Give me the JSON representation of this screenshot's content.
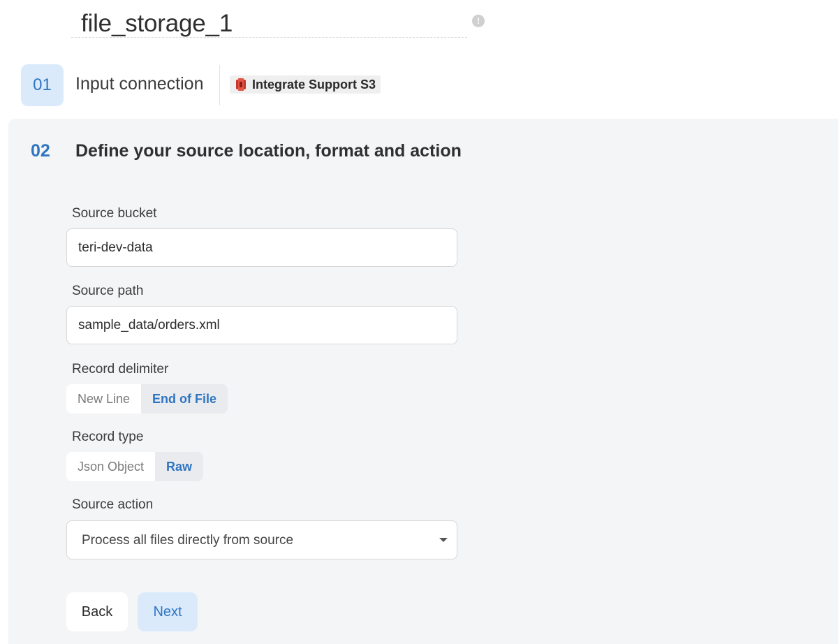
{
  "header": {
    "pipeline_name": "file_storage_1"
  },
  "step1": {
    "number": "01",
    "label": "Input connection",
    "connection_name": "Integrate Support S3",
    "connection_icon": "aws-s3-icon"
  },
  "step2": {
    "number": "02",
    "title": "Define your source location, format and action"
  },
  "form": {
    "source_bucket": {
      "label": "Source bucket",
      "value": "teri-dev-data"
    },
    "source_path": {
      "label": "Source path",
      "value": "sample_data/orders.xml"
    },
    "record_delimiter": {
      "label": "Record delimiter",
      "options": [
        "New Line",
        "End of File"
      ],
      "selected": "End of File"
    },
    "record_type": {
      "label": "Record type",
      "options": [
        "Json Object",
        "Raw"
      ],
      "selected": "Raw"
    },
    "source_action": {
      "label": "Source action",
      "value": "Process all files directly from source"
    }
  },
  "actions": {
    "back_label": "Back",
    "next_label": "Next"
  },
  "colors": {
    "accent": "#2f75c2",
    "accent_bg": "#dbeafb",
    "panel_bg": "#f4f5f7"
  }
}
